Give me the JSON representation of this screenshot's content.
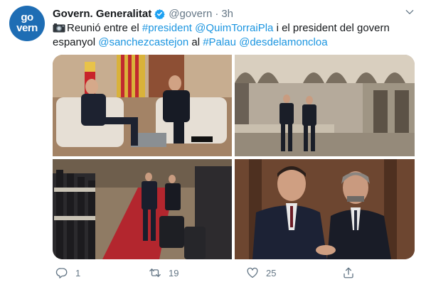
{
  "author": {
    "avatar_line1": "go",
    "avatar_line2": "vern",
    "name": "Govern. Generalitat",
    "handle": "@govern",
    "separator": "·",
    "time": "3h"
  },
  "tweet": {
    "segments": [
      {
        "text": "Reunió entre el ",
        "link": false
      },
      {
        "text": "#president",
        "link": true
      },
      {
        "text": " ",
        "link": false
      },
      {
        "text": "@QuimTorraiPla",
        "link": true
      },
      {
        "text": " i el president del govern espanyol ",
        "link": false
      },
      {
        "text": "@sanchezcastejon",
        "link": true
      },
      {
        "text": " al ",
        "link": false
      },
      {
        "text": "#Palau",
        "link": true
      },
      {
        "text": " ",
        "link": false
      },
      {
        "text": "@desdelamoncloa",
        "link": true
      }
    ]
  },
  "actions": {
    "replies": "1",
    "retweets": "19",
    "likes": "25"
  },
  "colors": {
    "link": "#1b95e0",
    "muted": "#657786",
    "verified": "#1da1f2",
    "avatar": "#1e6db4"
  }
}
